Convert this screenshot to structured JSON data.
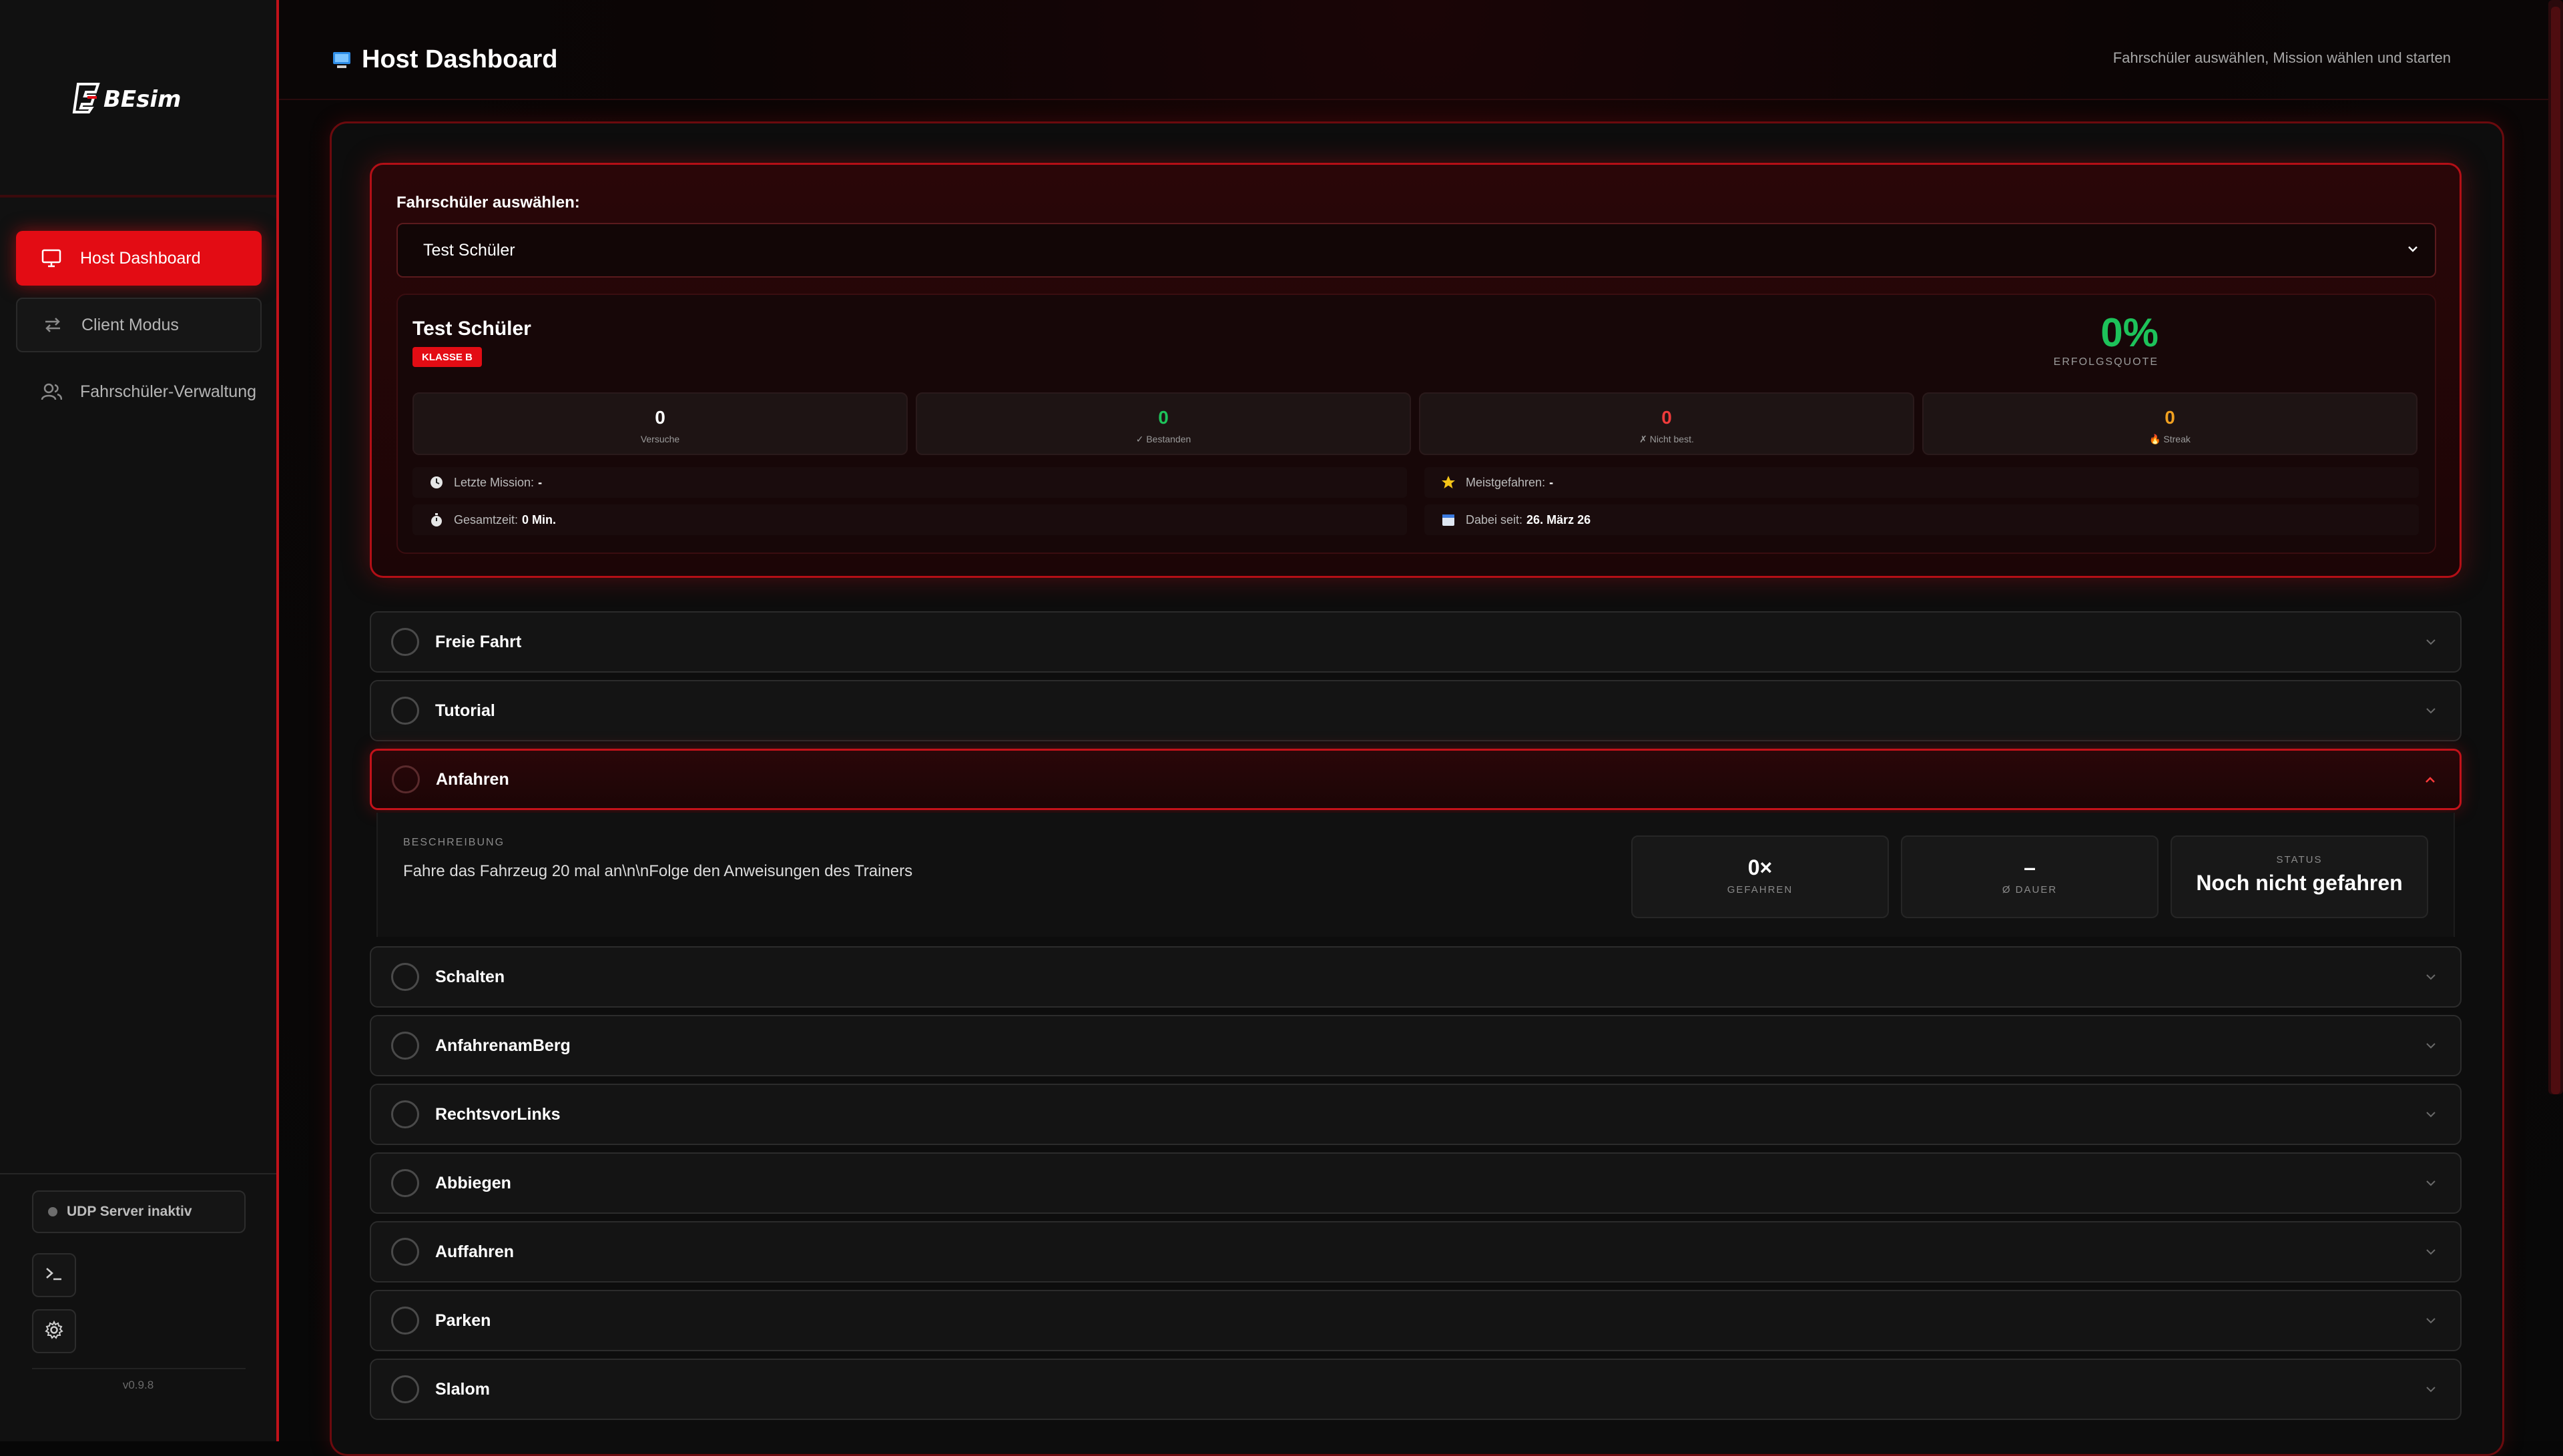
{
  "app": {
    "logo_text": "BEsim",
    "version": "v0.9.8",
    "accent_color": "#e30c14",
    "success_color": "#1dc25a"
  },
  "sidebar": {
    "items": [
      {
        "label": "Host Dashboard",
        "icon": "monitor-icon",
        "active": true
      },
      {
        "label": "Client Modus",
        "icon": "arrows-swap-icon",
        "active": false
      },
      {
        "label": "Fahrschüler-Verwaltung",
        "icon": "users-icon",
        "active": false
      }
    ],
    "udp_status": "UDP Server inaktiv",
    "terminal_icon": "terminal-icon",
    "settings_icon": "gear-icon"
  },
  "header": {
    "title": "Host Dashboard",
    "subtitle": "Fahrschüler auswählen, Mission wählen und starten"
  },
  "student_select": {
    "label": "Fahrschüler auswählen:",
    "selected": "Test Schüler"
  },
  "student": {
    "name": "Test Schüler",
    "class_badge": "KLASSE B",
    "success_rate": "0%",
    "success_label": "ERFOLGSQUOTE",
    "stats": [
      {
        "value": "0",
        "label": "Versuche",
        "color": "#ffffff"
      },
      {
        "value": "0",
        "label": "✓ Bestanden",
        "color": "#1dc25a"
      },
      {
        "value": "0",
        "label": "✗ Nicht best.",
        "color": "#ef3b3b"
      },
      {
        "value": "0",
        "label": "🔥 Streak",
        "color": "#f0a020"
      }
    ],
    "meta": {
      "last_mission_label": "Letzte Mission:",
      "last_mission_value": "-",
      "most_driven_label": "Meistgefahren:",
      "most_driven_value": "-",
      "total_time_label": "Gesamtzeit:",
      "total_time_value": "0 Min.",
      "since_label": "Dabei seit:",
      "since_value": "26. März 26"
    }
  },
  "missions": [
    {
      "title": "Freie Fahrt",
      "open": false
    },
    {
      "title": "Tutorial",
      "open": false
    },
    {
      "title": "Anfahren",
      "open": true
    },
    {
      "title": "Schalten",
      "open": false
    },
    {
      "title": "AnfahrenamBerg",
      "open": false
    },
    {
      "title": "RechtsvorLinks",
      "open": false
    },
    {
      "title": "Abbiegen",
      "open": false
    },
    {
      "title": "Auffahren",
      "open": false
    },
    {
      "title": "Parken",
      "open": false
    },
    {
      "title": "Slalom",
      "open": false
    }
  ],
  "mission_detail": {
    "description_label": "BESCHREIBUNG",
    "description": "Fahre das Fahrzeug 20 mal an\\n\\nFolge den Anweisungen des Trainers",
    "driven_value": "0×",
    "driven_label": "GEFAHREN",
    "duration_value": "–",
    "duration_label": "Ø DAUER",
    "status_label": "STATUS",
    "status_value": "Noch nicht gefahren"
  }
}
